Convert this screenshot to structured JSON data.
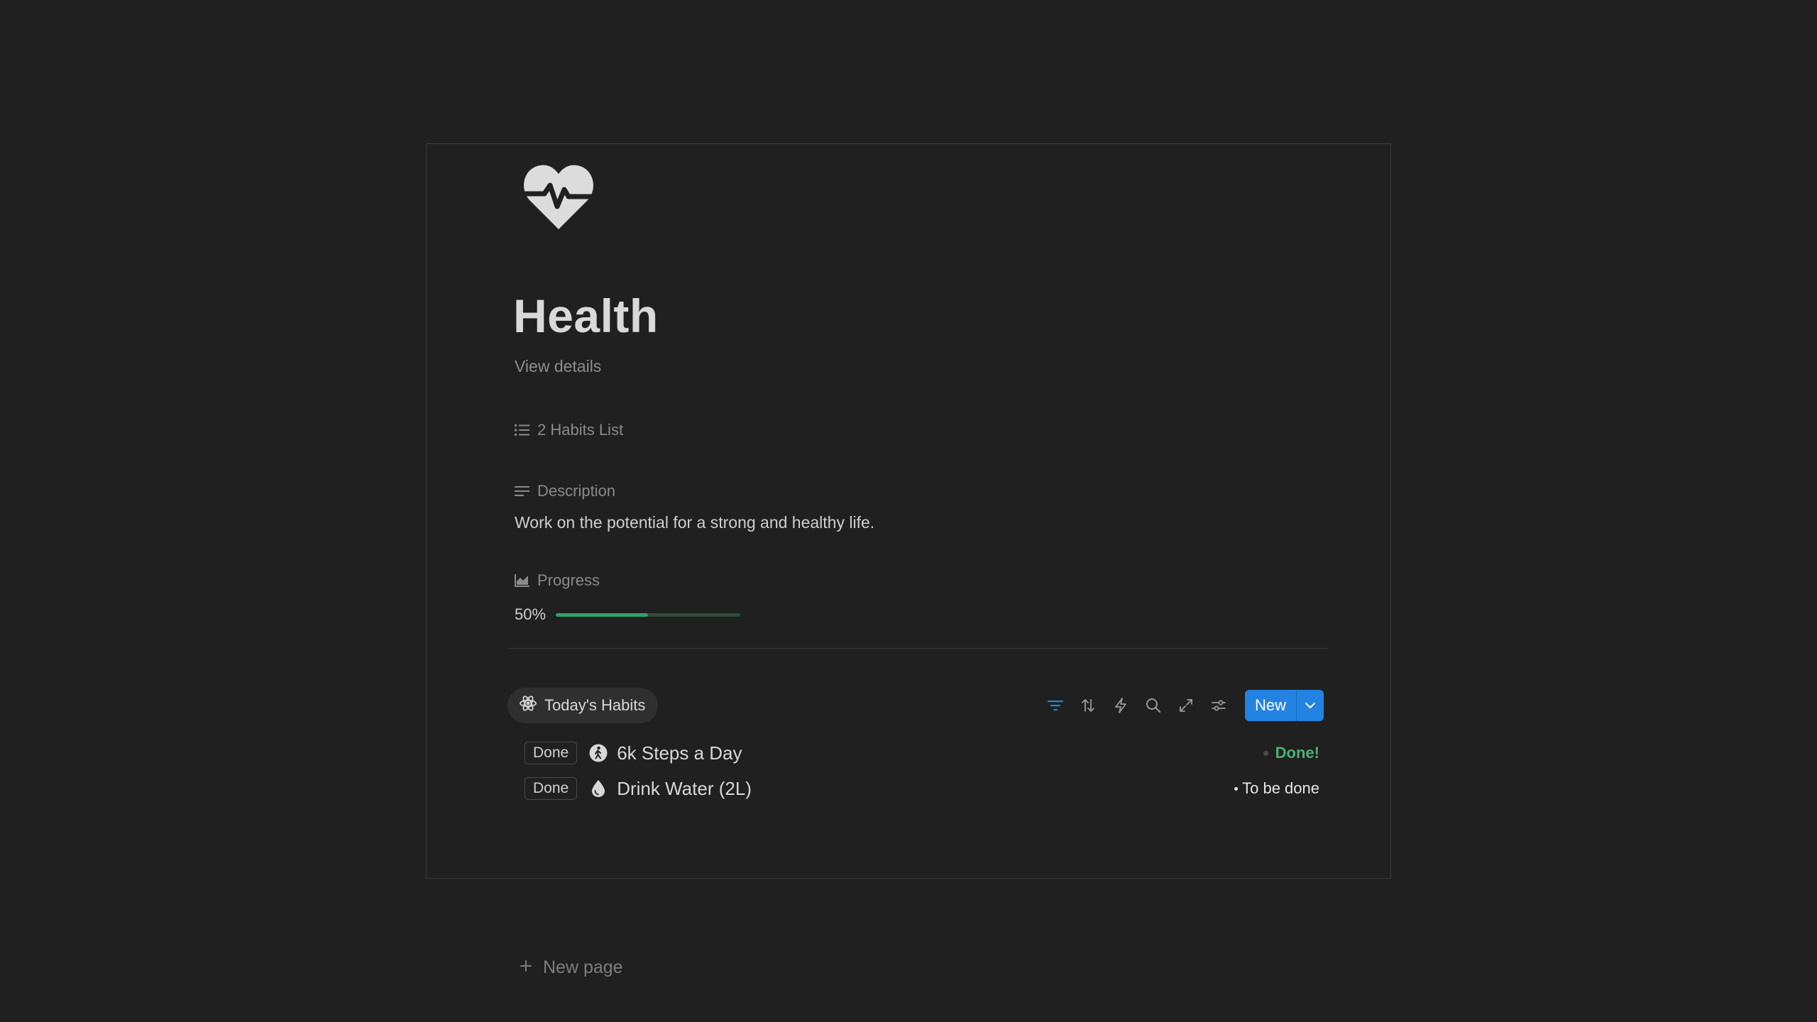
{
  "page": {
    "icon": "heart-pulse-icon",
    "title": "Health",
    "view_details": "View details"
  },
  "properties": {
    "relation": {
      "icon": "list-icon",
      "text": "2 Habits List"
    },
    "description": {
      "icon": "text-lines-icon",
      "label": "Description",
      "value": "Work on the potential for a strong and healthy life."
    },
    "progress": {
      "icon": "chart-icon",
      "label": "Progress",
      "value_text": "50%",
      "value": 0.5,
      "color": "#2ea36a"
    }
  },
  "database": {
    "view_tab": {
      "icon": "atom-icon",
      "label": "Today's Habits"
    },
    "toolbar": {
      "icons": [
        "filter-icon",
        "sort-icon",
        "lightning-icon",
        "search-icon",
        "expand-icon",
        "settings-sliders-icon"
      ],
      "new_label": "New",
      "accent": "#2383e2"
    },
    "habits": [
      {
        "button": "Done",
        "icon": "walking-person-icon",
        "name": "6k Steps a Day",
        "status": "Done!",
        "status_color": "#4caf72"
      },
      {
        "button": "Done",
        "icon": "water-drop-icon",
        "name": "Drink Water (2L)",
        "status": "To be done",
        "status_color": "#e6e6e6"
      }
    ],
    "new_page": "New page"
  }
}
